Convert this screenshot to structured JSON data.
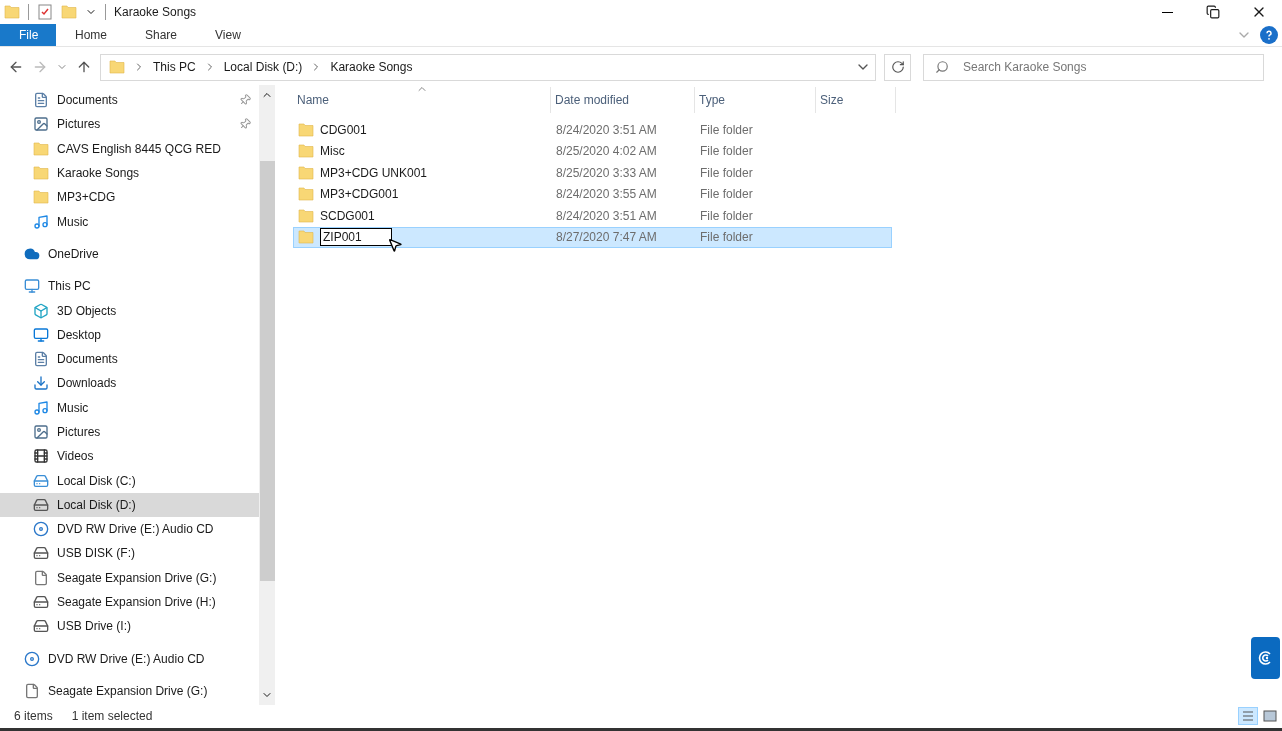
{
  "window": {
    "title": "Karaoke Songs"
  },
  "ribbon": {
    "tabs": [
      {
        "label": "File",
        "selected": true
      },
      {
        "label": "Home",
        "selected": false
      },
      {
        "label": "Share",
        "selected": false
      },
      {
        "label": "View",
        "selected": false
      }
    ]
  },
  "address": {
    "crumbs": [
      "This PC",
      "Local Disk (D:)",
      "Karaoke Songs"
    ]
  },
  "search": {
    "placeholder": "Search Karaoke Songs"
  },
  "sidebar": {
    "quick_access": [
      {
        "label": "Documents",
        "kind": "document",
        "pinned": true,
        "selected": false
      },
      {
        "label": "Pictures",
        "kind": "picture",
        "pinned": true,
        "selected": false
      },
      {
        "label": "CAVS English 8445 QCG RED",
        "kind": "folder",
        "pinned": false,
        "selected": false
      },
      {
        "label": "Karaoke Songs",
        "kind": "folder",
        "pinned": false,
        "selected": false
      },
      {
        "label": "MP3+CDG",
        "kind": "folder",
        "pinned": false,
        "selected": false
      },
      {
        "label": "Music",
        "kind": "music",
        "pinned": false,
        "selected": false
      }
    ],
    "items": [
      {
        "label": "OneDrive",
        "kind": "cloud",
        "selected": false
      },
      {
        "label": "This PC",
        "kind": "pc",
        "selected": false,
        "children": [
          {
            "label": "3D Objects",
            "kind": "cube",
            "selected": false
          },
          {
            "label": "Desktop",
            "kind": "desktop",
            "selected": false
          },
          {
            "label": "Documents",
            "kind": "document",
            "selected": false
          },
          {
            "label": "Downloads",
            "kind": "download",
            "selected": false
          },
          {
            "label": "Music",
            "kind": "music",
            "selected": false
          },
          {
            "label": "Pictures",
            "kind": "picture",
            "selected": false
          },
          {
            "label": "Videos",
            "kind": "video",
            "selected": false
          },
          {
            "label": "Local Disk (C:)",
            "kind": "system",
            "selected": false
          },
          {
            "label": "Local Disk (D:)",
            "kind": "drive",
            "selected": true
          },
          {
            "label": "DVD RW Drive (E:) Audio CD",
            "kind": "dvd",
            "selected": false
          },
          {
            "label": "USB DISK (F:)",
            "kind": "drive",
            "selected": false
          },
          {
            "label": "Seagate Expansion Drive (G:)",
            "kind": "file",
            "selected": false
          },
          {
            "label": "Seagate Expansion Drive (H:)",
            "kind": "drive",
            "selected": false
          },
          {
            "label": "USB Drive (I:)",
            "kind": "drive",
            "selected": false
          }
        ]
      },
      {
        "label": "DVD RW Drive (E:) Audio CD",
        "kind": "dvd",
        "selected": false
      },
      {
        "label": "Seagate Expansion Drive (G:)",
        "kind": "file",
        "selected": false
      }
    ]
  },
  "table": {
    "columns": [
      "Name",
      "Date modified",
      "Type",
      "Size"
    ],
    "rows": [
      {
        "name": "CDG001",
        "date": "8/24/2020 3:51 AM",
        "type": "File folder",
        "selected": false,
        "renaming": false
      },
      {
        "name": "Misc",
        "date": "8/25/2020 4:02 AM",
        "type": "File folder",
        "selected": false,
        "renaming": false
      },
      {
        "name": "MP3+CDG UNK001",
        "date": "8/25/2020 3:33 AM",
        "type": "File folder",
        "selected": false,
        "renaming": false
      },
      {
        "name": "MP3+CDG001",
        "date": "8/24/2020 3:55 AM",
        "type": "File folder",
        "selected": false,
        "renaming": false
      },
      {
        "name": "SCDG001",
        "date": "8/24/2020 3:51 AM",
        "type": "File folder",
        "selected": false,
        "renaming": false
      },
      {
        "name": "ZIP001",
        "date": "8/27/2020 7:47 AM",
        "type": "File folder",
        "selected": true,
        "renaming": true
      }
    ]
  },
  "status_bar": {
    "count": "6 items",
    "selection": "1 item selected"
  }
}
